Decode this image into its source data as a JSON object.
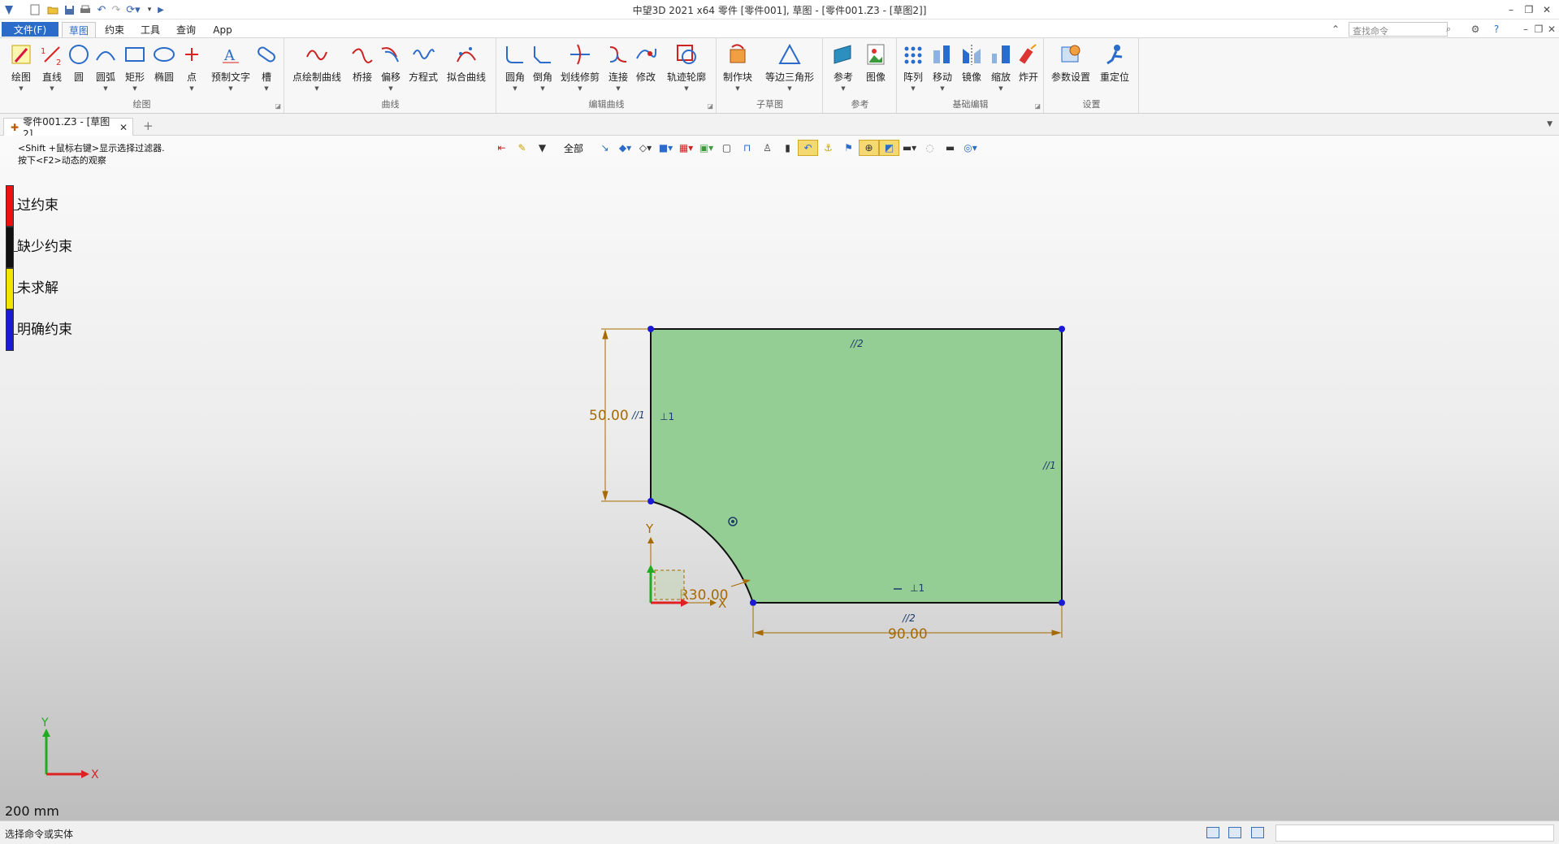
{
  "window": {
    "title": "中望3D 2021 x64      零件 [零件001], 草图 - [零件001.Z3 - [草图2]]",
    "accent": "#2b6bc9"
  },
  "menu": {
    "file": "文件(F)",
    "tabs": [
      {
        "label": "草图",
        "active": true
      },
      {
        "label": "约束",
        "active": false
      },
      {
        "label": "工具",
        "active": false
      },
      {
        "label": "查询",
        "active": false
      },
      {
        "label": "App",
        "active": false
      }
    ],
    "search_placeholder": "查找命令"
  },
  "ribbon": {
    "groups": [
      {
        "label": "绘图",
        "buttons": [
          "绘图",
          "直线",
          "圆",
          "圆弧",
          "矩形",
          "椭圆",
          "点",
          "预制文字",
          "槽"
        ]
      },
      {
        "label": "曲线",
        "buttons": [
          "点绘制曲线",
          "桥接",
          "偏移",
          "方程式",
          "拟合曲线"
        ]
      },
      {
        "label": "编辑曲线",
        "buttons": [
          "圆角",
          "倒角",
          "划线修剪",
          "连接",
          "修改",
          "轨迹轮廓"
        ]
      },
      {
        "label": "子草图",
        "buttons": [
          "制作块",
          "等边三角形"
        ]
      },
      {
        "label": "参考",
        "buttons": [
          "参考",
          "图像"
        ]
      },
      {
        "label": "基础编辑",
        "buttons": [
          "阵列",
          "移动",
          "镜像",
          "缩放",
          "炸开"
        ]
      },
      {
        "label": "设置",
        "buttons": [
          "参数设置",
          "重定位"
        ]
      }
    ]
  },
  "document": {
    "tab_label": "零件001.Z3 - [草图2]"
  },
  "viewport": {
    "hint_line1": "<Shift +鼠标右键>显示选择过滤器.",
    "hint_line2": "按下<F2>动态的观察",
    "filter_label": "全部",
    "scale_label": "200 mm"
  },
  "legend": [
    {
      "label": "过约束",
      "color": "#ee1111"
    },
    {
      "label": "缺少约束",
      "color": "#111111"
    },
    {
      "label": "未求解",
      "color": "#f2e600"
    },
    {
      "label": "明确约束",
      "color": "#1a1ad6"
    }
  ],
  "sketch": {
    "fill_color": "#95ce95",
    "dimension_color": "#a66a00",
    "dimensions": {
      "height": "50.00",
      "width": "90.00",
      "radius": "R30.00"
    },
    "constraint_labels": {
      "parallel_2": "//2",
      "parallel_1": "//1",
      "perp_1": "⊥1"
    },
    "axes": {
      "x": "X",
      "y": "Y"
    }
  },
  "status": {
    "text": "选择命令或实体"
  }
}
